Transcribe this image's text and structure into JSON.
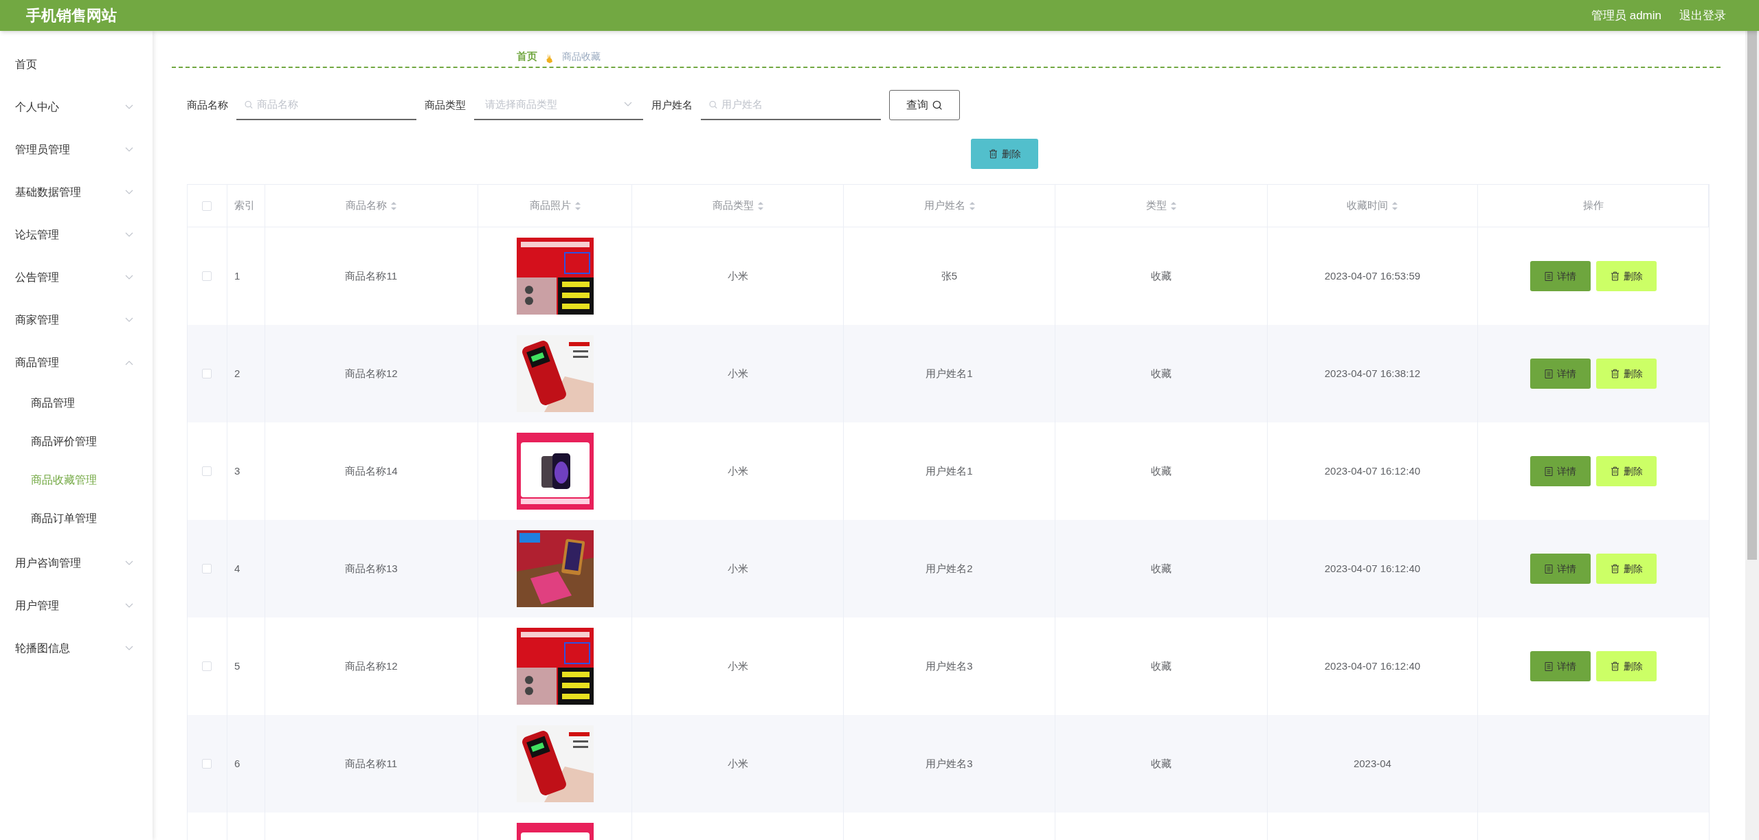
{
  "header": {
    "title": "手机销售网站",
    "user": "管理员 admin",
    "logout": "退出登录"
  },
  "sidebar": {
    "items": [
      {
        "label": "首页"
      },
      {
        "label": "个人中心",
        "expanded": false
      },
      {
        "label": "管理员管理",
        "expanded": false
      },
      {
        "label": "基础数据管理",
        "expanded": false
      },
      {
        "label": "论坛管理",
        "expanded": false
      },
      {
        "label": "公告管理",
        "expanded": false
      },
      {
        "label": "商家管理",
        "expanded": false
      },
      {
        "label": "商品管理",
        "expanded": true,
        "children": [
          {
            "label": "商品管理",
            "selected": false
          },
          {
            "label": "商品评价管理",
            "selected": false
          },
          {
            "label": "商品收藏管理",
            "selected": true
          },
          {
            "label": "商品订单管理",
            "selected": false
          }
        ]
      },
      {
        "label": "用户咨询管理",
        "expanded": false
      },
      {
        "label": "用户管理",
        "expanded": false
      },
      {
        "label": "轮播图信息",
        "expanded": false
      }
    ]
  },
  "breadcrumb": [
    "首页",
    "商品收藏"
  ],
  "search": {
    "fields": [
      {
        "label": "商品名称",
        "kind": "text",
        "placeholder": "商品名称"
      },
      {
        "label": "商品类型",
        "kind": "select",
        "placeholder": "请选择商品类型"
      },
      {
        "label": "用户姓名",
        "kind": "text",
        "placeholder": "用户姓名"
      }
    ],
    "button": "查询"
  },
  "bulk_delete": "删除",
  "table": {
    "select_all_checked": false,
    "columns": [
      {
        "label": "索引",
        "sortable": false
      },
      {
        "label": "商品名称",
        "sortable": true
      },
      {
        "label": "商品照片",
        "sortable": true
      },
      {
        "label": "商品类型",
        "sortable": true
      },
      {
        "label": "用户姓名",
        "sortable": true
      },
      {
        "label": "类型",
        "sortable": true
      },
      {
        "label": "收藏时间",
        "sortable": true
      },
      {
        "label": "操作",
        "sortable": false
      }
    ],
    "rows": [
      {
        "checked": false,
        "index": "1",
        "name": "商品名称11",
        "photo": {
          "kind": "picture"
        },
        "type": "小米",
        "user": "张5",
        "kind": "收藏",
        "time": "2023-04-07 16:53:59",
        "actions": [
          "详情",
          "删除"
        ]
      },
      {
        "checked": false,
        "index": "2",
        "name": "商品名称12",
        "photo": {
          "kind": "picture"
        },
        "type": "小米",
        "user": "用户姓名1",
        "kind": "收藏",
        "time": "2023-04-07 16:38:12",
        "actions": [
          "详情",
          "删除"
        ]
      },
      {
        "checked": false,
        "index": "3",
        "name": "商品名称14",
        "photo": {
          "kind": "picture"
        },
        "type": "小米",
        "user": "用户姓名1",
        "kind": "收藏",
        "time": "2023-04-07 16:12:40",
        "actions": [
          "详情",
          "删除"
        ]
      },
      {
        "checked": false,
        "index": "4",
        "name": "商品名称13",
        "photo": {
          "kind": "picture"
        },
        "type": "小米",
        "user": "用户姓名2",
        "kind": "收藏",
        "time": "2023-04-07 16:12:40",
        "actions": [
          "详情",
          "删除"
        ]
      },
      {
        "checked": false,
        "index": "5",
        "name": "商品名称12",
        "photo": {
          "kind": "picture"
        },
        "type": "小米",
        "user": "用户姓名3",
        "kind": "收藏",
        "time": "2023-04-07 16:12:40",
        "actions": [
          "详情",
          "删除"
        ]
      },
      {
        "checked": false,
        "index": "6",
        "name": "商品名称11",
        "photo": {
          "kind": "picture"
        },
        "type": "小米",
        "user": "用户姓名3",
        "kind": "收藏",
        "time": "2023-04"
      },
      {
        "photo": {
          "kind": "picture"
        }
      }
    ]
  }
}
